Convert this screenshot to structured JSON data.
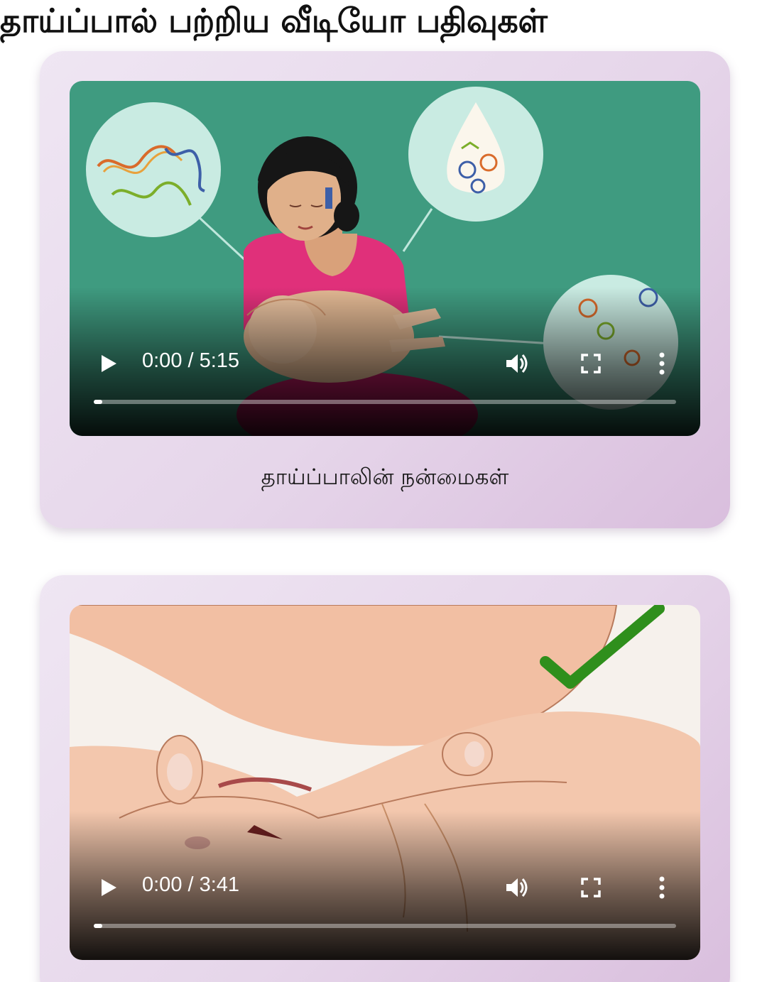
{
  "page": {
    "title": "தாய்ப்பால் பற்றிய வீடியோ பதிவுகள்"
  },
  "videos": [
    {
      "time": "0:00 / 5:15",
      "caption": "தாய்ப்பாலின் நன்மைகள்",
      "progress_fraction": 0.0,
      "thumbnail": "mother-breastfeeding-illustration"
    },
    {
      "time": "0:00 / 3:41",
      "progress_fraction": 0.0,
      "thumbnail": "baby-latch-closeup-illustration"
    }
  ],
  "icons": {
    "play": "play-icon",
    "volume": "volume-icon",
    "fullscreen": "fullscreen-icon",
    "more": "more-vertical-icon",
    "check": "check-icon"
  },
  "colors": {
    "video1_background": "#3f9b80",
    "card_gradient_start": "#efe6f3",
    "card_gradient_end": "#d9bedd",
    "check_green": "#2f8f1c"
  }
}
